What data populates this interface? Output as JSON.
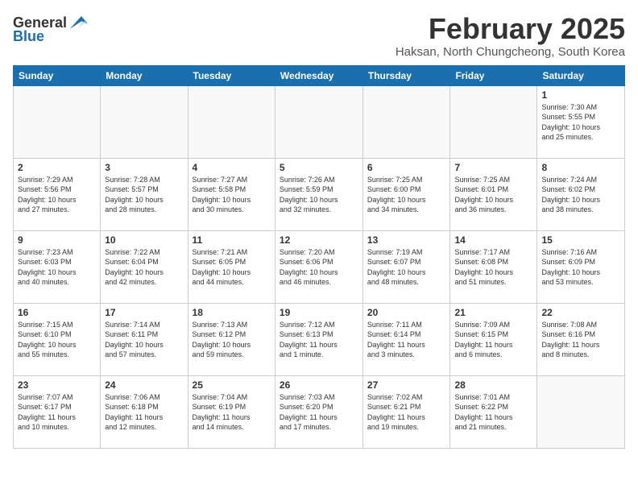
{
  "header": {
    "logo_general": "General",
    "logo_blue": "Blue",
    "title": "February 2025",
    "subtitle": "Haksan, North Chungcheong, South Korea"
  },
  "weekdays": [
    "Sunday",
    "Monday",
    "Tuesday",
    "Wednesday",
    "Thursday",
    "Friday",
    "Saturday"
  ],
  "weeks": [
    [
      {
        "day": "",
        "info": ""
      },
      {
        "day": "",
        "info": ""
      },
      {
        "day": "",
        "info": ""
      },
      {
        "day": "",
        "info": ""
      },
      {
        "day": "",
        "info": ""
      },
      {
        "day": "",
        "info": ""
      },
      {
        "day": "1",
        "info": "Sunrise: 7:30 AM\nSunset: 5:55 PM\nDaylight: 10 hours\nand 25 minutes."
      }
    ],
    [
      {
        "day": "2",
        "info": "Sunrise: 7:29 AM\nSunset: 5:56 PM\nDaylight: 10 hours\nand 27 minutes."
      },
      {
        "day": "3",
        "info": "Sunrise: 7:28 AM\nSunset: 5:57 PM\nDaylight: 10 hours\nand 28 minutes."
      },
      {
        "day": "4",
        "info": "Sunrise: 7:27 AM\nSunset: 5:58 PM\nDaylight: 10 hours\nand 30 minutes."
      },
      {
        "day": "5",
        "info": "Sunrise: 7:26 AM\nSunset: 5:59 PM\nDaylight: 10 hours\nand 32 minutes."
      },
      {
        "day": "6",
        "info": "Sunrise: 7:25 AM\nSunset: 6:00 PM\nDaylight: 10 hours\nand 34 minutes."
      },
      {
        "day": "7",
        "info": "Sunrise: 7:25 AM\nSunset: 6:01 PM\nDaylight: 10 hours\nand 36 minutes."
      },
      {
        "day": "8",
        "info": "Sunrise: 7:24 AM\nSunset: 6:02 PM\nDaylight: 10 hours\nand 38 minutes."
      }
    ],
    [
      {
        "day": "9",
        "info": "Sunrise: 7:23 AM\nSunset: 6:03 PM\nDaylight: 10 hours\nand 40 minutes."
      },
      {
        "day": "10",
        "info": "Sunrise: 7:22 AM\nSunset: 6:04 PM\nDaylight: 10 hours\nand 42 minutes."
      },
      {
        "day": "11",
        "info": "Sunrise: 7:21 AM\nSunset: 6:05 PM\nDaylight: 10 hours\nand 44 minutes."
      },
      {
        "day": "12",
        "info": "Sunrise: 7:20 AM\nSunset: 6:06 PM\nDaylight: 10 hours\nand 46 minutes."
      },
      {
        "day": "13",
        "info": "Sunrise: 7:19 AM\nSunset: 6:07 PM\nDaylight: 10 hours\nand 48 minutes."
      },
      {
        "day": "14",
        "info": "Sunrise: 7:17 AM\nSunset: 6:08 PM\nDaylight: 10 hours\nand 51 minutes."
      },
      {
        "day": "15",
        "info": "Sunrise: 7:16 AM\nSunset: 6:09 PM\nDaylight: 10 hours\nand 53 minutes."
      }
    ],
    [
      {
        "day": "16",
        "info": "Sunrise: 7:15 AM\nSunset: 6:10 PM\nDaylight: 10 hours\nand 55 minutes."
      },
      {
        "day": "17",
        "info": "Sunrise: 7:14 AM\nSunset: 6:11 PM\nDaylight: 10 hours\nand 57 minutes."
      },
      {
        "day": "18",
        "info": "Sunrise: 7:13 AM\nSunset: 6:12 PM\nDaylight: 10 hours\nand 59 minutes."
      },
      {
        "day": "19",
        "info": "Sunrise: 7:12 AM\nSunset: 6:13 PM\nDaylight: 11 hours\nand 1 minute."
      },
      {
        "day": "20",
        "info": "Sunrise: 7:11 AM\nSunset: 6:14 PM\nDaylight: 11 hours\nand 3 minutes."
      },
      {
        "day": "21",
        "info": "Sunrise: 7:09 AM\nSunset: 6:15 PM\nDaylight: 11 hours\nand 6 minutes."
      },
      {
        "day": "22",
        "info": "Sunrise: 7:08 AM\nSunset: 6:16 PM\nDaylight: 11 hours\nand 8 minutes."
      }
    ],
    [
      {
        "day": "23",
        "info": "Sunrise: 7:07 AM\nSunset: 6:17 PM\nDaylight: 11 hours\nand 10 minutes."
      },
      {
        "day": "24",
        "info": "Sunrise: 7:06 AM\nSunset: 6:18 PM\nDaylight: 11 hours\nand 12 minutes."
      },
      {
        "day": "25",
        "info": "Sunrise: 7:04 AM\nSunset: 6:19 PM\nDaylight: 11 hours\nand 14 minutes."
      },
      {
        "day": "26",
        "info": "Sunrise: 7:03 AM\nSunset: 6:20 PM\nDaylight: 11 hours\nand 17 minutes."
      },
      {
        "day": "27",
        "info": "Sunrise: 7:02 AM\nSunset: 6:21 PM\nDaylight: 11 hours\nand 19 minutes."
      },
      {
        "day": "28",
        "info": "Sunrise: 7:01 AM\nSunset: 6:22 PM\nDaylight: 11 hours\nand 21 minutes."
      },
      {
        "day": "",
        "info": ""
      }
    ]
  ]
}
